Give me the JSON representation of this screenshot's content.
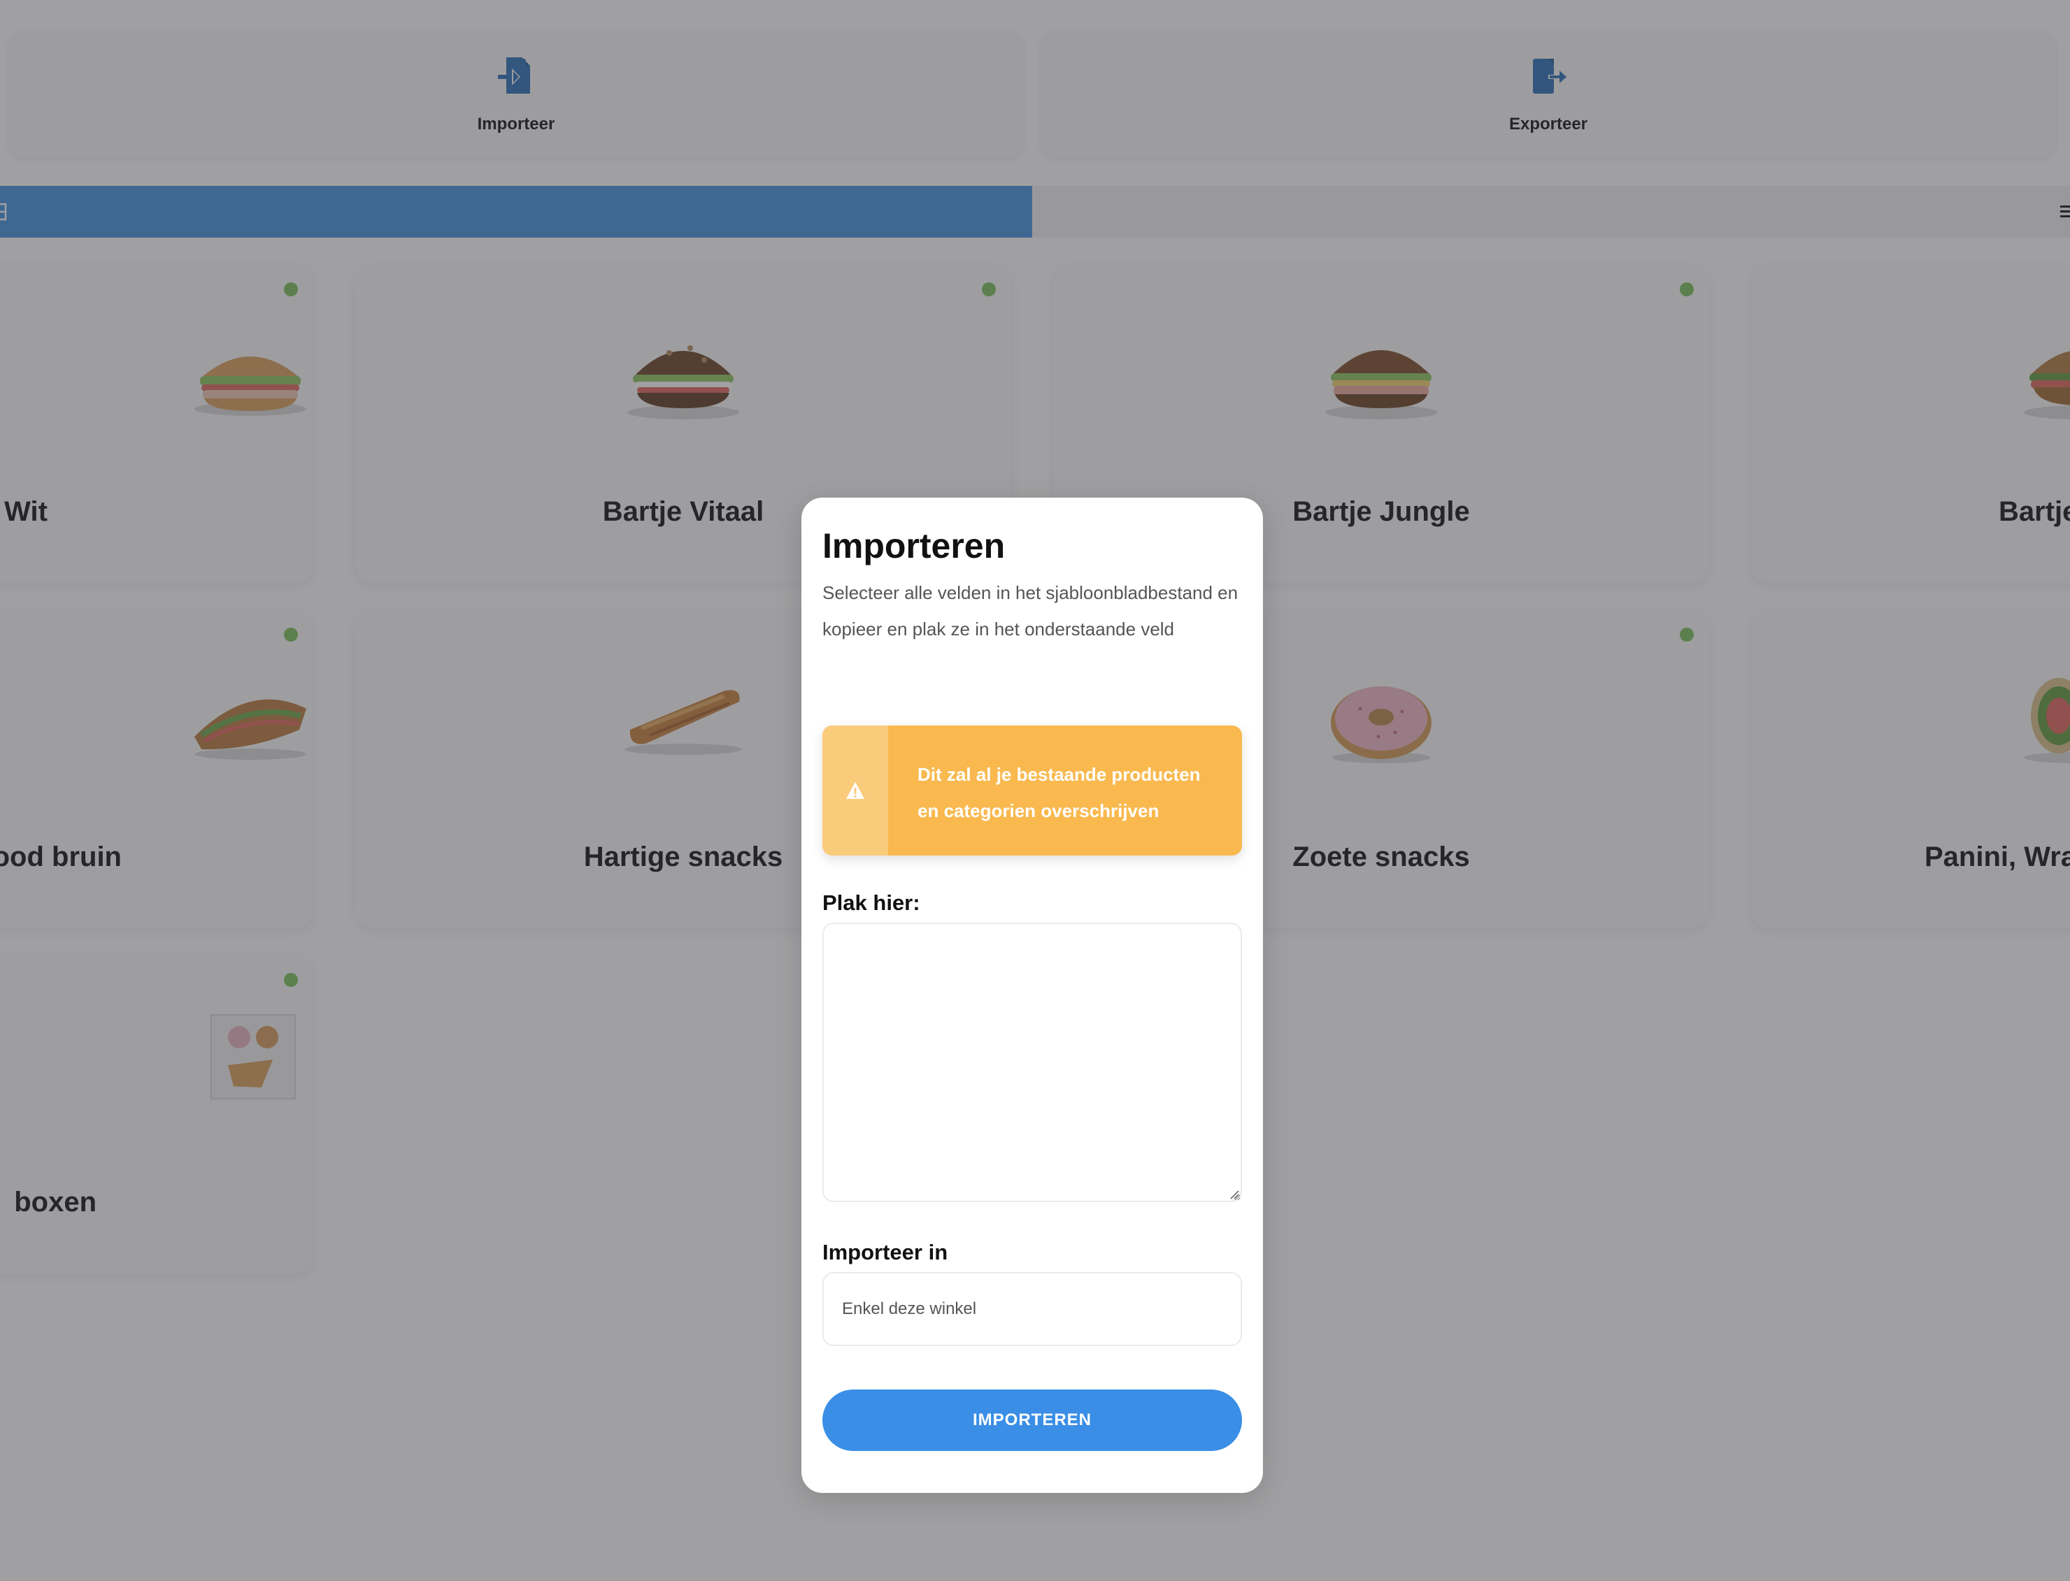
{
  "toolbar": {
    "import_label": "Importeer",
    "export_label": "Exporteer"
  },
  "colors": {
    "accent": "#3a8ee6",
    "toggle_active": "#3f8fe0",
    "status_dot": "#7bc158",
    "warning": "#f9b94f",
    "overlay": "rgba(62,62,66,0.49)"
  },
  "categories": [
    {
      "name": "Wit",
      "status": "active",
      "photo": "sandwich-icon"
    },
    {
      "name": "Bartje Vitaal",
      "status": "active",
      "photo": "sandwich-icon"
    },
    {
      "name": "Bartje Jungle",
      "status": "active",
      "photo": "sandwich-icon"
    },
    {
      "name": "Bartje",
      "status": "active",
      "photo": "sandwich-icon"
    },
    {
      "name": "ood bruin",
      "status": "active",
      "photo": "baguette-icon"
    },
    {
      "name": "Hartige snacks",
      "status": "inactive",
      "photo": "sausage-roll-icon"
    },
    {
      "name": "Zoete snacks",
      "status": "active",
      "photo": "donut-icon"
    },
    {
      "name": "Panini, Wra",
      "status": "inactive",
      "photo": "wrap-icon"
    },
    {
      "name": "boxen",
      "status": "active",
      "photo": "box-icon"
    }
  ],
  "modal": {
    "title": "Importeren",
    "description": "Selecteer alle velden in het sjabloonbladbestand en kopieer en plak ze in het onderstaande veld",
    "warning": "Dit zal al je bestaande producten en categorien overschrijven",
    "paste_label": "Plak hier:",
    "paste_value": "",
    "target_label": "Importeer in",
    "target_value": "Enkel deze winkel",
    "submit_label": "IMPORTEREN"
  }
}
